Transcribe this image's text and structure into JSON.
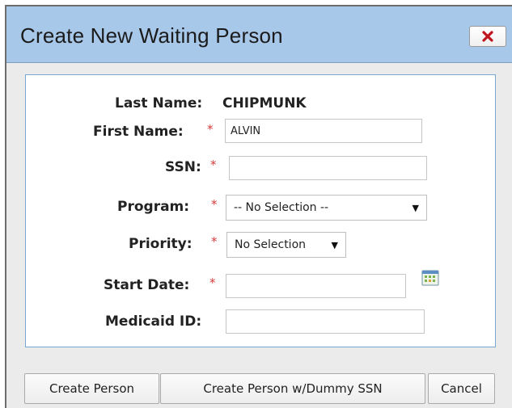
{
  "dialog": {
    "title": "Create New Waiting Person",
    "close_icon": "close-x-icon"
  },
  "form": {
    "last_name": {
      "label": "Last Name:",
      "value": "CHIPMUNK"
    },
    "first_name": {
      "label": "First Name:",
      "required_mark": "*",
      "value": "ALVIN"
    },
    "ssn": {
      "label": "SSN:",
      "required_mark": "*",
      "value": ""
    },
    "program": {
      "label": "Program:",
      "required_mark": "*",
      "selected": "-- No Selection --"
    },
    "priority": {
      "label": "Priority:",
      "required_mark": "*",
      "selected": "No Selection"
    },
    "start_date": {
      "label": "Start Date:",
      "required_mark": "*",
      "value": "",
      "picker_icon": "calendar-icon"
    },
    "medicaid_id": {
      "label": "Medicaid ID:",
      "value": ""
    }
  },
  "buttons": {
    "create_person": "Create Person",
    "create_person_dummy": "Create Person w/Dummy SSN",
    "cancel": "Cancel"
  },
  "colors": {
    "titlebar": "#a8c8ea",
    "panel_border": "#7aa6d2",
    "required": "#d33a3a",
    "close_x": "#c0141c"
  }
}
